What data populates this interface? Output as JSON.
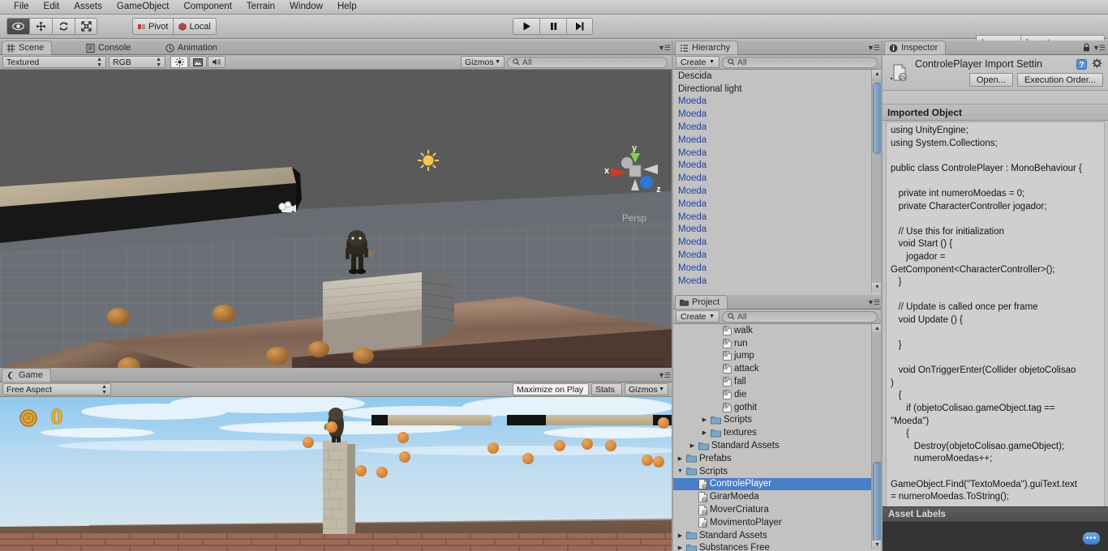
{
  "menubar": {
    "items": [
      "File",
      "Edit",
      "Assets",
      "GameObject",
      "Component",
      "Terrain",
      "Window",
      "Help"
    ]
  },
  "toolbar": {
    "tools": [
      {
        "name": "hand-tool",
        "icon": "eye-icon",
        "active": true
      },
      {
        "name": "move-tool",
        "icon": "move-arrows-icon",
        "active": false
      },
      {
        "name": "rotate-tool",
        "icon": "rotate-icon",
        "active": false
      },
      {
        "name": "scale-tool",
        "icon": "scale-icon",
        "active": false
      }
    ],
    "pivot_label": "Pivot",
    "local_label": "Local",
    "play_label": "▶",
    "pause_label": "❚❚",
    "step_label": "▶❙",
    "layers_label": "Layers",
    "layout_label": "layout",
    "dropdown_arrow": "▼"
  },
  "scene_view": {
    "tabs": [
      {
        "label": "Scene",
        "icon": "grid-icon",
        "active": true
      },
      {
        "label": "Console",
        "icon": "console-icon",
        "active": false
      },
      {
        "label": "Animation",
        "icon": "clock-icon",
        "active": false
      }
    ],
    "draw_mode": "Textured",
    "color_mode": "RGB",
    "gizmos_label": "Gizmos",
    "search_placeholder": "All",
    "search_value": "",
    "gizmo": {
      "axis_y": "y",
      "axis_x": "x",
      "axis_z": "z",
      "projection": "Persp"
    }
  },
  "game_view": {
    "tabs": [
      {
        "label": "Game",
        "icon": "gamepad-icon",
        "active": true
      }
    ],
    "aspect": "Free Aspect",
    "maximize_label": "Maximize on Play",
    "stats_label": "Stats",
    "gizmos_label": "Gizmos",
    "hud_coin_count": "0"
  },
  "hierarchy": {
    "tab_label": "Hierarchy",
    "create_label": "Create",
    "search_placeholder": "All",
    "search_value": "",
    "items": [
      {
        "label": "Descida",
        "prefab": false
      },
      {
        "label": "Directional light",
        "prefab": false
      },
      {
        "label": "Moeda",
        "prefab": true
      },
      {
        "label": "Moeda",
        "prefab": true
      },
      {
        "label": "Moeda",
        "prefab": true
      },
      {
        "label": "Moeda",
        "prefab": true
      },
      {
        "label": "Moeda",
        "prefab": true
      },
      {
        "label": "Moeda",
        "prefab": true
      },
      {
        "label": "Moeda",
        "prefab": true
      },
      {
        "label": "Moeda",
        "prefab": true
      },
      {
        "label": "Moeda",
        "prefab": true
      },
      {
        "label": "Moeda",
        "prefab": true
      },
      {
        "label": "Moeda",
        "prefab": true
      },
      {
        "label": "Moeda",
        "prefab": true
      },
      {
        "label": "Moeda",
        "prefab": true
      },
      {
        "label": "Moeda",
        "prefab": true
      },
      {
        "label": "Moeda",
        "prefab": true
      }
    ]
  },
  "project": {
    "tab_label": "Project",
    "create_label": "Create",
    "search_placeholder": "All",
    "search_value": "",
    "items": [
      {
        "label": "walk",
        "type": "clip",
        "indent": 3,
        "expander": "",
        "selected": false
      },
      {
        "label": "run",
        "type": "clip",
        "indent": 3,
        "expander": "",
        "selected": false
      },
      {
        "label": "jump",
        "type": "clip",
        "indent": 3,
        "expander": "",
        "selected": false
      },
      {
        "label": "attack",
        "type": "clip",
        "indent": 3,
        "expander": "",
        "selected": false
      },
      {
        "label": "fall",
        "type": "clip",
        "indent": 3,
        "expander": "",
        "selected": false
      },
      {
        "label": "die",
        "type": "clip",
        "indent": 3,
        "expander": "",
        "selected": false
      },
      {
        "label": "gothit",
        "type": "clip",
        "indent": 3,
        "expander": "",
        "selected": false
      },
      {
        "label": "Scripts",
        "type": "folder",
        "indent": 2,
        "expander": "▶",
        "selected": false
      },
      {
        "label": "textures",
        "type": "folder",
        "indent": 2,
        "expander": "▶",
        "selected": false
      },
      {
        "label": "Standard Assets",
        "type": "folder",
        "indent": 1,
        "expander": "▶",
        "selected": false
      },
      {
        "label": "Prefabs",
        "type": "folder",
        "indent": 0,
        "expander": "▶",
        "selected": false
      },
      {
        "label": "Scripts",
        "type": "folder",
        "indent": 0,
        "expander": "▼",
        "selected": false
      },
      {
        "label": "ControlePlayer",
        "type": "script",
        "indent": 1,
        "expander": "",
        "selected": true
      },
      {
        "label": "GirarMoeda",
        "type": "script",
        "indent": 1,
        "expander": "",
        "selected": false
      },
      {
        "label": "MoverCriatura",
        "type": "script",
        "indent": 1,
        "expander": "",
        "selected": false
      },
      {
        "label": "MovimentoPlayer",
        "type": "script",
        "indent": 1,
        "expander": "",
        "selected": false
      },
      {
        "label": "Standard Assets",
        "type": "folder",
        "indent": 0,
        "expander": "▶",
        "selected": false
      },
      {
        "label": "Substances  Free",
        "type": "folder",
        "indent": 0,
        "expander": "▶",
        "selected": false
      }
    ]
  },
  "inspector": {
    "tab_label": "Inspector",
    "title": "ControlePlayer Import Settin",
    "open_label": "Open...",
    "execution_order_label": "Execution Order...",
    "imported_object_label": "Imported Object",
    "asset_labels_label": "Asset Labels",
    "label_bubble": "•••",
    "code": "using UnityEngine;\nusing System.Collections;\n\npublic class ControlePlayer : MonoBehaviour {\n\n   private int numeroMoedas = 0;\n   private CharacterController jogador;\n\n   // Use this for initialization\n   void Start () {\n      jogador =\nGetComponent<CharacterController>();\n   }\n\n   // Update is called once per frame\n   void Update () {\n\n   }\n\n   void OnTriggerEnter(Collider objetoColisao\n)\n   {\n      if (objetoColisao.gameObject.tag ==\n\"Moeda\")\n      {\n         Destroy(objetoColisao.gameObject);\n         numeroMoedas++;\n\nGameObject.Find(\"TextoMoeda\").guiText.text\n= numeroMoedas.ToString();\n\n      }\n\n   }\n}"
  },
  "colors": {
    "panel_bg": "#c2c2c2",
    "selection_blue": "#4a7ec8",
    "prefab_blue": "#20449a",
    "scene_bg": "#5a5a5a",
    "sky_top": "#9ed2ef",
    "coin_orange": "#e09040"
  }
}
